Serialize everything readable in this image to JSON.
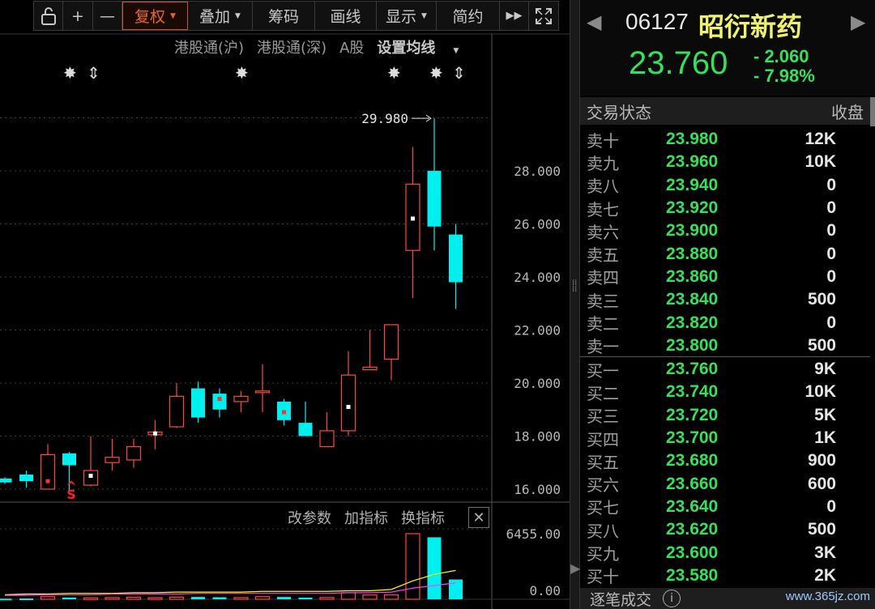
{
  "toolbar": {
    "items": [
      {
        "label": "",
        "icon": "unlock-icon"
      },
      {
        "label": "+",
        "icon": "zoom-in-icon"
      },
      {
        "label": "—",
        "icon": "zoom-out-icon"
      },
      {
        "label": "复权",
        "active": true
      },
      {
        "label": "叠加"
      },
      {
        "label": "筹码"
      },
      {
        "label": "画线"
      },
      {
        "label": "显示"
      },
      {
        "label": "简约"
      },
      {
        "label": "▶▶",
        "icon": "fast-forward-icon"
      },
      {
        "label": "",
        "icon": "fullscreen-icon"
      }
    ]
  },
  "sublinks": {
    "hgt_sh": "港股通(沪)",
    "hgt_sz": "港股通(深)",
    "a_share": "A股",
    "ma_settings": "设置均线"
  },
  "indicator_bar": {
    "modify": "改参数",
    "add": "加指标",
    "switch": "换指标",
    "close": "✕"
  },
  "chart_data": {
    "type": "candlestick",
    "y_ticks": [
      "28.000",
      "26.000",
      "24.000",
      "22.000",
      "20.000",
      "18.000",
      "16.000"
    ],
    "ylim": [
      14.2,
      30.9
    ],
    "peak_label": "29.980",
    "volume_ticks": [
      "6455.00",
      "0.00"
    ],
    "candles": [
      {
        "o": 16.25,
        "c": 16.4,
        "h": 16.45,
        "l": 16.2,
        "up": false
      },
      {
        "o": 16.3,
        "c": 16.55,
        "h": 16.7,
        "l": 16.05,
        "up": false
      },
      {
        "o": 16.0,
        "c": 17.3,
        "h": 17.7,
        "l": 16.0,
        "up": true
      },
      {
        "o": 17.35,
        "c": 16.9,
        "h": 17.4,
        "l": 15.8,
        "up": false
      },
      {
        "o": 16.15,
        "c": 16.7,
        "h": 18.0,
        "l": 16.1,
        "up": true
      },
      {
        "o": 17.0,
        "c": 17.2,
        "h": 17.9,
        "l": 16.7,
        "up": true
      },
      {
        "o": 17.1,
        "c": 17.6,
        "h": 17.9,
        "l": 16.8,
        "up": true
      },
      {
        "o": 18.05,
        "c": 18.15,
        "h": 18.6,
        "l": 17.5,
        "up": true
      },
      {
        "o": 18.35,
        "c": 19.5,
        "h": 20.0,
        "l": 18.3,
        "up": true
      },
      {
        "o": 19.8,
        "c": 18.7,
        "h": 20.05,
        "l": 18.5,
        "up": false
      },
      {
        "o": 19.6,
        "c": 19.0,
        "h": 19.8,
        "l": 18.7,
        "up": false
      },
      {
        "o": 19.3,
        "c": 19.5,
        "h": 19.7,
        "l": 18.9,
        "up": true
      },
      {
        "o": 19.7,
        "c": 19.7,
        "h": 20.7,
        "l": 18.9,
        "up": true
      },
      {
        "o": 19.3,
        "c": 18.6,
        "h": 19.4,
        "l": 18.4,
        "up": false
      },
      {
        "o": 18.5,
        "c": 18.0,
        "h": 19.3,
        "l": 18.0,
        "up": false
      },
      {
        "o": 17.6,
        "c": 18.2,
        "h": 18.9,
        "l": 17.6,
        "up": true
      },
      {
        "o": 18.2,
        "c": 20.3,
        "h": 21.2,
        "l": 18.0,
        "up": true
      },
      {
        "o": 20.5,
        "c": 20.6,
        "h": 22.0,
        "l": 20.5,
        "up": true
      },
      {
        "o": 20.9,
        "c": 22.2,
        "h": 22.2,
        "l": 20.1,
        "up": true
      },
      {
        "o": 25.0,
        "c": 27.5,
        "h": 28.9,
        "l": 23.2,
        "up": true
      },
      {
        "o": 28.0,
        "c": 25.9,
        "h": 29.98,
        "l": 25.0,
        "up": false
      },
      {
        "o": 25.6,
        "c": 23.8,
        "h": 26.0,
        "l": 22.8,
        "up": false
      }
    ],
    "volumes": [
      60,
      80,
      260,
      170,
      140,
      160,
      190,
      150,
      210,
      230,
      200,
      160,
      260,
      230,
      160,
      170,
      650,
      420,
      430,
      6455,
      6100,
      1950
    ],
    "ma1": [
      0.07,
      0.08,
      0.08,
      0.09,
      0.09,
      0.09,
      0.1,
      0.1,
      0.11,
      0.11,
      0.11,
      0.11,
      0.12,
      0.12,
      0.12,
      0.12,
      0.13,
      0.13,
      0.15,
      0.28,
      0.38,
      0.44
    ],
    "ma2": [
      0.06,
      0.06,
      0.07,
      0.07,
      0.07,
      0.08,
      0.08,
      0.08,
      0.08,
      0.09,
      0.09,
      0.09,
      0.09,
      0.09,
      0.09,
      0.09,
      0.1,
      0.1,
      0.11,
      0.17,
      0.21,
      0.25
    ]
  },
  "quote": {
    "code": "06127",
    "name": "昭衍新药",
    "price": "23.760",
    "change": "- 2.060",
    "change_pct": "- 7.98%",
    "status_label": "交易状态",
    "status_value": "收盘"
  },
  "sell_orders": [
    {
      "label": "卖十",
      "price": "23.980",
      "vol": "12K"
    },
    {
      "label": "卖九",
      "price": "23.960",
      "vol": "10K"
    },
    {
      "label": "卖八",
      "price": "23.940",
      "vol": "0"
    },
    {
      "label": "卖七",
      "price": "23.920",
      "vol": "0"
    },
    {
      "label": "卖六",
      "price": "23.900",
      "vol": "0"
    },
    {
      "label": "卖五",
      "price": "23.880",
      "vol": "0"
    },
    {
      "label": "卖四",
      "price": "23.860",
      "vol": "0"
    },
    {
      "label": "卖三",
      "price": "23.840",
      "vol": "500"
    },
    {
      "label": "卖二",
      "price": "23.820",
      "vol": "0"
    },
    {
      "label": "卖一",
      "price": "23.800",
      "vol": "500"
    }
  ],
  "buy_orders": [
    {
      "label": "买一",
      "price": "23.760",
      "vol": "9K"
    },
    {
      "label": "买二",
      "price": "23.740",
      "vol": "10K"
    },
    {
      "label": "买三",
      "price": "23.720",
      "vol": "5K"
    },
    {
      "label": "买四",
      "price": "23.700",
      "vol": "1K"
    },
    {
      "label": "买五",
      "price": "23.680",
      "vol": "900"
    },
    {
      "label": "买六",
      "price": "23.660",
      "vol": "600"
    },
    {
      "label": "买七",
      "price": "23.640",
      "vol": "0"
    },
    {
      "label": "买八",
      "price": "23.620",
      "vol": "500"
    },
    {
      "label": "买九",
      "price": "23.600",
      "vol": "3K"
    },
    {
      "label": "买十",
      "price": "23.580",
      "vol": "2K"
    }
  ],
  "bottom": {
    "label": "逐笔成交",
    "watermark": "www.365jz.com"
  },
  "colors": {
    "up": "#ff4a3a",
    "down": "#00f0f0",
    "green": "#36e05b",
    "ma1": "#ffff00",
    "ma2": "#ff40ff",
    "grid": "#3a3a3a"
  }
}
